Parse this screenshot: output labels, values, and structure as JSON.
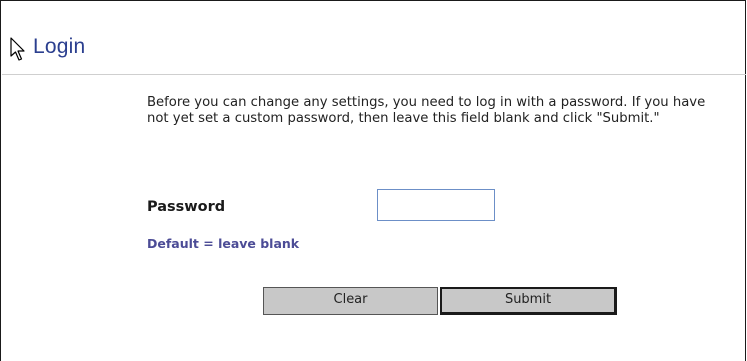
{
  "page": {
    "title": "Login",
    "instructions": "Before you can change any settings, you need to log in with a password. If you have not yet set a custom password, then leave this field blank and click \"Submit.\""
  },
  "form": {
    "password_label": "Password",
    "password_value": "",
    "default_hint": "Default = leave blank"
  },
  "buttons": {
    "clear_label": "Clear",
    "submit_label": "Submit"
  },
  "colors": {
    "title": "#2b3f8f",
    "hint": "#4c4c96",
    "button_face": "#c8c8c8",
    "input_border": "#6c8fc7"
  },
  "icons": {
    "cursor": "mouse-pointer-icon"
  }
}
